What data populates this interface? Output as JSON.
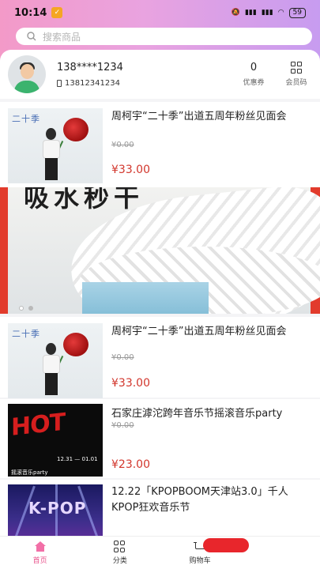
{
  "status_bar": {
    "time": "10:14",
    "battery": "59"
  },
  "search": {
    "placeholder": "搜索商品"
  },
  "user": {
    "name": "138****1234",
    "phone": "13812341234",
    "coupon_count": "0",
    "coupon_label": "优惠券",
    "member_label": "会员码"
  },
  "products": [
    {
      "title": "周柯宇“二十季”出道五周年粉丝见面会",
      "old_price": "¥0.00",
      "price": "¥33.00",
      "thumb_text": "二十季"
    },
    {
      "title": "周柯宇“二十季”出道五周年粉丝见面会",
      "old_price": "¥0.00",
      "price": "¥33.00",
      "thumb_text": "二十季"
    },
    {
      "title": "石家庄滹沱跨年音乐节摇滚音乐party",
      "old_price": "¥0.00",
      "price": "¥23.00",
      "thumb_text": "HOT",
      "thumb_dates": "12.31 — 01.01",
      "thumb_caption": "摇滚音乐party"
    },
    {
      "title": "12.22「KPOPBOOM天津站3.0」千人KPOP狂欢音乐节",
      "thumb_text": "K-POP"
    }
  ],
  "banner": {
    "headline": "吸水秒干"
  },
  "tabbar": {
    "home": "首页",
    "category": "分类",
    "cart": "购物车"
  },
  "colors": {
    "accent": "#e84f8a",
    "price": "#d2362c",
    "header_gradient_start": "#f39ac8",
    "header_gradient_end": "#c79cf0"
  }
}
